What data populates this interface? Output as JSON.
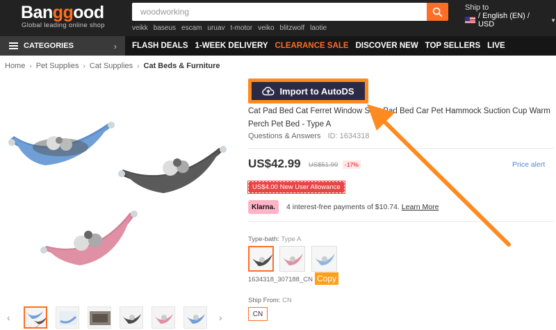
{
  "header": {
    "logo_prefix": "Ban",
    "logo_highlight": "gg",
    "logo_suffix": "ood",
    "tagline": "Global leading online shop",
    "search_value": "woodworking",
    "hot_words": [
      "veikk",
      "baseus",
      "escam",
      "uruav",
      "t-motor",
      "veiko",
      "blitzwolf",
      "laotie"
    ],
    "ship_to_label": "Ship to",
    "ship_to_value": "/ English (EN) / USD"
  },
  "nav": {
    "categories_label": "CATEGORIES",
    "links": [
      "FLASH DEALS",
      "1-WEEK DELIVERY",
      "CLEARANCE SALE",
      "DISCOVER NEW",
      "TOP SELLERS",
      "LIVE"
    ]
  },
  "breadcrumb": [
    "Home",
    "Pet Supplies",
    "Cat Supplies",
    "Cat Beds & Furniture"
  ],
  "product": {
    "autods_label": "Import to AutoDS",
    "title": "Cat Pad Bed Cat Ferret Window Seat Pad Bed Car Pet Hammock Suction Cup Warm Perch Pet Bed - Type A",
    "qa_label": "Questions & Answers",
    "id_label": "ID: 1634318",
    "price": "US$42.99",
    "old_price": "US$51.99",
    "discount": "-17%",
    "price_alert": "Price alert",
    "allowance": "US$4.00 New User Allowance",
    "klarna_logo": "Klarna.",
    "klarna_text": "4 interest-free payments of $10.74.",
    "klarna_link": "Learn More",
    "type_label": "Type-bath:",
    "type_value": "Type A",
    "sku": "1634318_307188_CN",
    "copy_label": "Copy",
    "ship_from_label": "Ship From:",
    "ship_from_value": "CN",
    "ship_option": "CN"
  },
  "colors": {
    "accent": "#ff6e26",
    "header_bg": "#222222",
    "autods_bg": "#2d2a46",
    "annotation": "#ff8a1f"
  }
}
